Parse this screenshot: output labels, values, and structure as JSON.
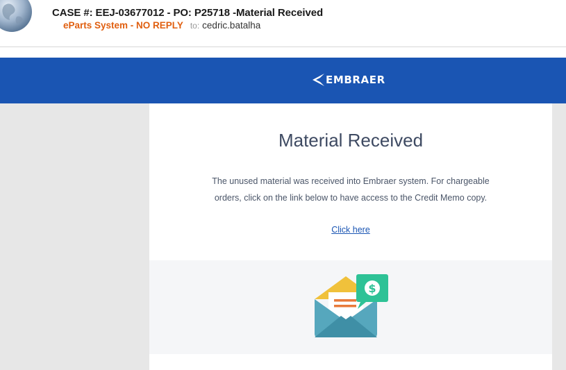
{
  "email": {
    "subject": "CASE #: EEJ-03677012 - PO: P25718 -Material Received",
    "sender": "eParts System - NO REPLY",
    "to_label": "to:",
    "recipient": "cedric.batalha"
  },
  "banner": {
    "brand": "EMBRAER",
    "color": "#1a55b3"
  },
  "content": {
    "title": "Material Received",
    "body": "The unused material was received into Embraer system. For chargeable orders, click on the link below to have access to the Credit Memo copy.",
    "link_text": "Click here"
  },
  "icons": {
    "avatar": "globe-icon",
    "brand": "embraer-logo",
    "illustration": "envelope-dollar-icon"
  }
}
